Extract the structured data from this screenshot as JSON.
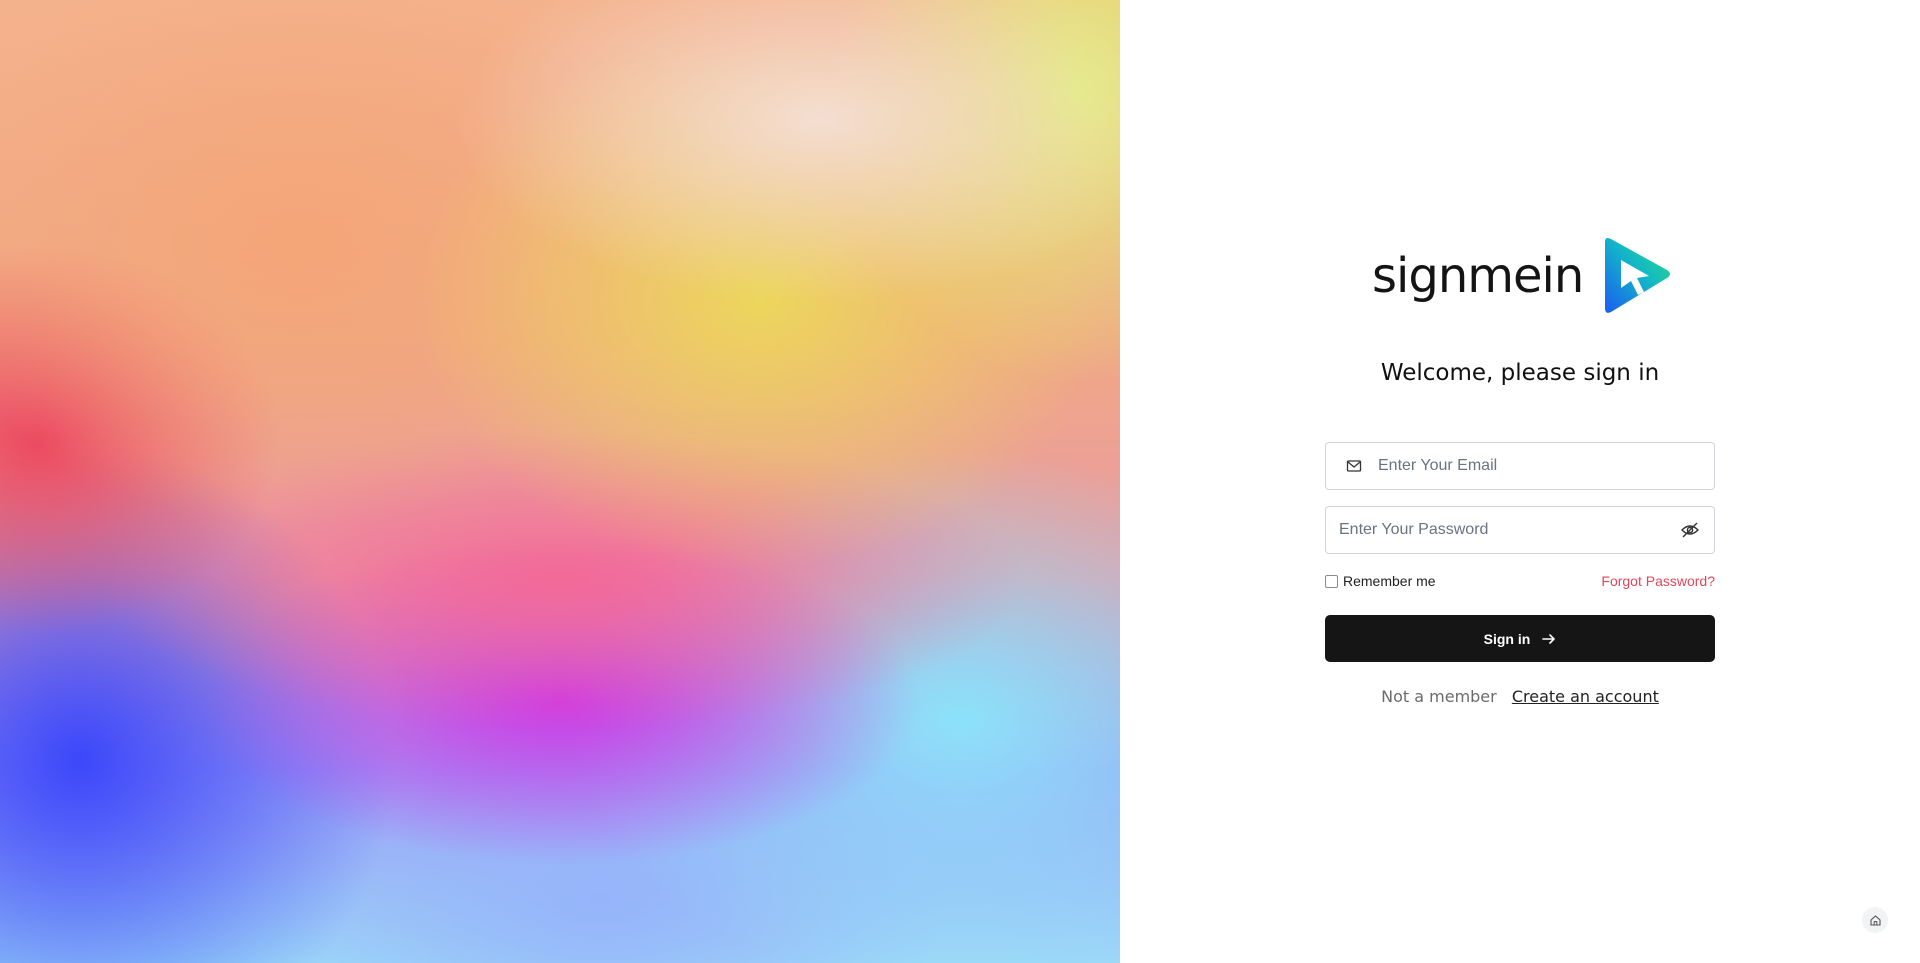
{
  "brand": {
    "name": "signmein",
    "logo_icon": "play-cursor-logo-icon"
  },
  "heading": "Welcome, please sign in",
  "form": {
    "email": {
      "placeholder": "Enter Your Email",
      "value": "",
      "icon": "mail-icon"
    },
    "password": {
      "placeholder": "Enter Your Password",
      "value": "",
      "icon": "eye-off-icon"
    },
    "remember_label": "Remember me",
    "remember_checked": false,
    "forgot_label": "Forgot Password?",
    "submit_label": "Sign in",
    "submit_icon": "arrow-right-icon"
  },
  "footer": {
    "prompt": "Not a member",
    "link_label": "Create an account"
  },
  "floating": {
    "icon": "home-icon"
  },
  "colors": {
    "accent_red": "#e0475a",
    "button_bg": "#151515",
    "logo_blue": "#1a6cf0",
    "logo_green": "#22d38a"
  }
}
